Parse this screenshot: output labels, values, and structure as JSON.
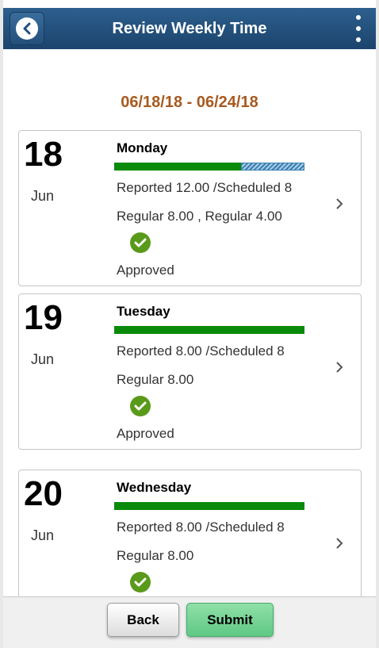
{
  "header": {
    "title": "Review Weekly Time",
    "back_icon": "chevron-left-icon",
    "menu_icon": "kebab-menu-icon",
    "color": "#1b446c"
  },
  "date_range": "06/18/18 - 06/24/18",
  "days": [
    {
      "day": "18",
      "month": "Jun",
      "weekday": "Monday",
      "reported": "Reported 12.00 /Scheduled 8",
      "regular": "Regular 8.00 , Regular 4.00",
      "status": "Approved",
      "reported_hours": 12,
      "scheduled_hours": 8
    },
    {
      "day": "19",
      "month": "Jun",
      "weekday": "Tuesday",
      "reported": "Reported 8.00 /Scheduled 8",
      "regular": "Regular 8.00",
      "status": "Approved",
      "reported_hours": 8,
      "scheduled_hours": 8
    },
    {
      "day": "20",
      "month": "Jun",
      "weekday": "Wednesday",
      "reported": "Reported 8.00 /Scheduled 8",
      "regular": "Regular 8.00",
      "status": "",
      "reported_hours": 8,
      "scheduled_hours": 8
    }
  ],
  "footer": {
    "back_label": "Back",
    "submit_label": "Submit"
  },
  "colors": {
    "date_range": "#a85a1f",
    "bar_green": "#0a8a0a",
    "check_green": "#5a9a1a",
    "submit": "#5fc884"
  }
}
